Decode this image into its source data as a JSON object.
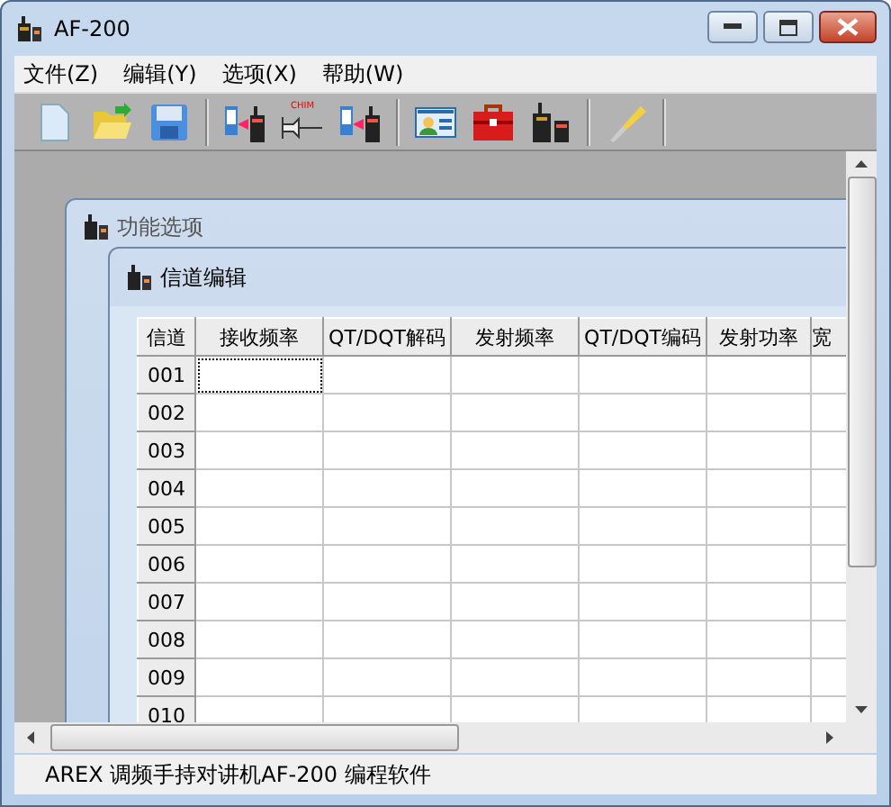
{
  "window": {
    "title": "AF-200"
  },
  "menu": [
    {
      "label": "文件(Z)"
    },
    {
      "label": "编辑(Y)"
    },
    {
      "label": "选项(X)"
    },
    {
      "label": "帮助(W)"
    }
  ],
  "toolbar": [
    {
      "kind": "new"
    },
    {
      "kind": "open"
    },
    {
      "kind": "save"
    },
    {
      "kind": "sep"
    },
    {
      "kind": "read"
    },
    {
      "kind": "chirp",
      "label": "CHIM"
    },
    {
      "kind": "write"
    },
    {
      "kind": "sep"
    },
    {
      "kind": "card"
    },
    {
      "kind": "toolbox"
    },
    {
      "kind": "radio"
    },
    {
      "kind": "sep"
    },
    {
      "kind": "tool"
    },
    {
      "kind": "sep"
    }
  ],
  "options_window": {
    "title": "功能选项"
  },
  "channel_window": {
    "title": "信道编辑",
    "columns": [
      "信道",
      "接收频率",
      "QT/DQT解码",
      "发射频率",
      "QT/DQT编码",
      "发射功率",
      "宽"
    ],
    "rows": [
      {
        "label": "001",
        "focused": true
      },
      {
        "label": "002",
        "focused": false
      },
      {
        "label": "003",
        "focused": false
      },
      {
        "label": "004",
        "focused": false
      },
      {
        "label": "005",
        "focused": false
      },
      {
        "label": "006",
        "focused": false
      },
      {
        "label": "007",
        "focused": false
      },
      {
        "label": "008",
        "focused": false
      },
      {
        "label": "009",
        "focused": false
      },
      {
        "label": "010",
        "focused": false
      }
    ]
  },
  "status_bar": {
    "text": "AREX 调频手持对讲机AF-200 编程软件"
  }
}
